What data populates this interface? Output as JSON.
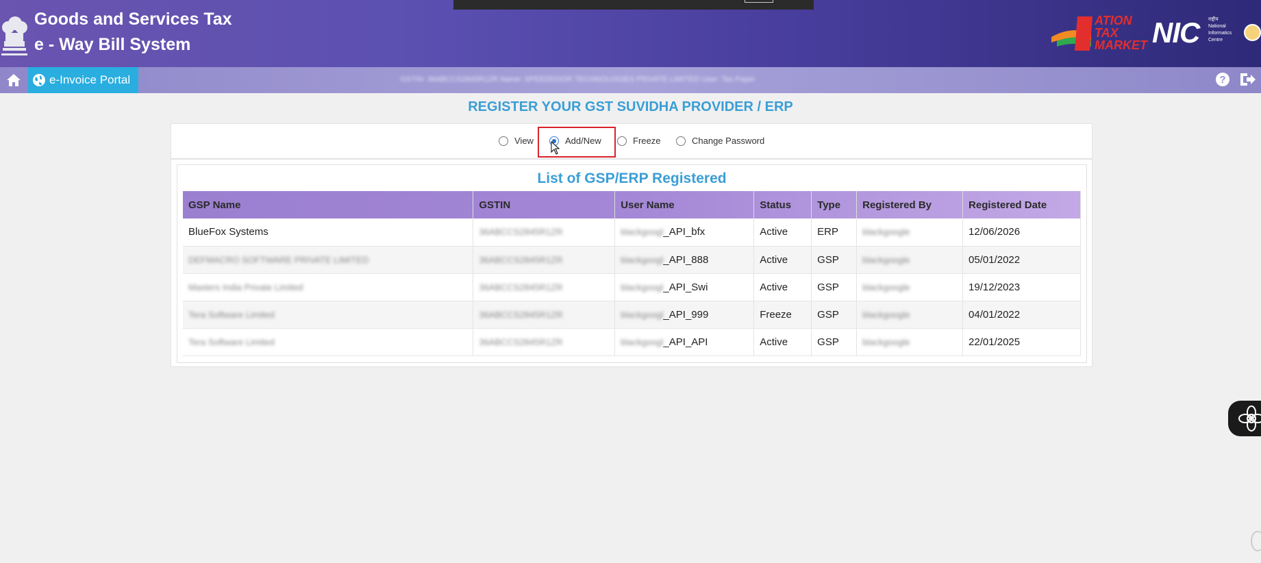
{
  "header": {
    "title_line1": "Goods and Services Tax",
    "title_line2": "e - Way Bill System",
    "emblem_icon": "national-emblem-icon",
    "logo_ntm": "NATION TAX MARKET",
    "logo_nic": "NIC"
  },
  "navbar": {
    "portal_label": "e-Invoice Portal",
    "user_info": "GSTIN: 36ABCCS2845R1ZR Name: SPEEDDOOR TECHNOLOGIES PRIVATE LIMITED User: Tax Payer"
  },
  "page": {
    "heading": "REGISTER YOUR GST SUVIDHA PROVIDER / ERP",
    "radio_options": [
      {
        "label": "View",
        "checked": false
      },
      {
        "label": "Add/New",
        "checked": true
      },
      {
        "label": "Freeze",
        "checked": false
      },
      {
        "label": "Change Password",
        "checked": false
      }
    ],
    "list_title": "List of GSP/ERP Registered"
  },
  "table": {
    "columns": [
      "GSP Name",
      "GSTIN",
      "User Name",
      "Status",
      "Type",
      "Registered By",
      "Registered Date"
    ],
    "rows": [
      {
        "gsp_name": "BlueFox Systems",
        "gstin": "36ABCCS2845R1ZR",
        "user_name_prefix": "blackgoogl",
        "user_name_suffix": "_API_bfx",
        "status": "Active",
        "type": "ERP",
        "registered_by": "blackgoogle",
        "date": "12/06/2026"
      },
      {
        "gsp_name": "DEFMACRO SOFTWARE PRIVATE LIMITED",
        "gstin": "36ABCCS2845R1ZR",
        "user_name_prefix": "blackgoogl",
        "user_name_suffix": "_API_888",
        "status": "Active",
        "type": "GSP",
        "registered_by": "blackgoogle",
        "date": "05/01/2022"
      },
      {
        "gsp_name": "Masters India Private Limited",
        "gstin": "36ABCCS2845R1ZR",
        "user_name_prefix": "blackgoogl",
        "user_name_suffix": "_API_Swi",
        "status": "Active",
        "type": "GSP",
        "registered_by": "blackgoogle",
        "date": "19/12/2023"
      },
      {
        "gsp_name": "Tera Software Limited",
        "gstin": "36ABCCS2845R1ZR",
        "user_name_prefix": "blackgoogl",
        "user_name_suffix": "_API_999",
        "status": "Freeze",
        "type": "GSP",
        "registered_by": "blackgoogle",
        "date": "04/01/2022"
      },
      {
        "gsp_name": "Tera Software Limited",
        "gstin": "36ABCCS2845R1ZR",
        "user_name_prefix": "blackgoogl",
        "user_name_suffix": "_API_API",
        "status": "Active",
        "type": "GSP",
        "registered_by": "blackgoogle",
        "date": "22/01/2025"
      }
    ]
  },
  "colors": {
    "heading_blue": "#3a9ed6",
    "portal_button": "#29aedf",
    "highlight_red": "#d8232a",
    "table_header": "#a487d6"
  }
}
